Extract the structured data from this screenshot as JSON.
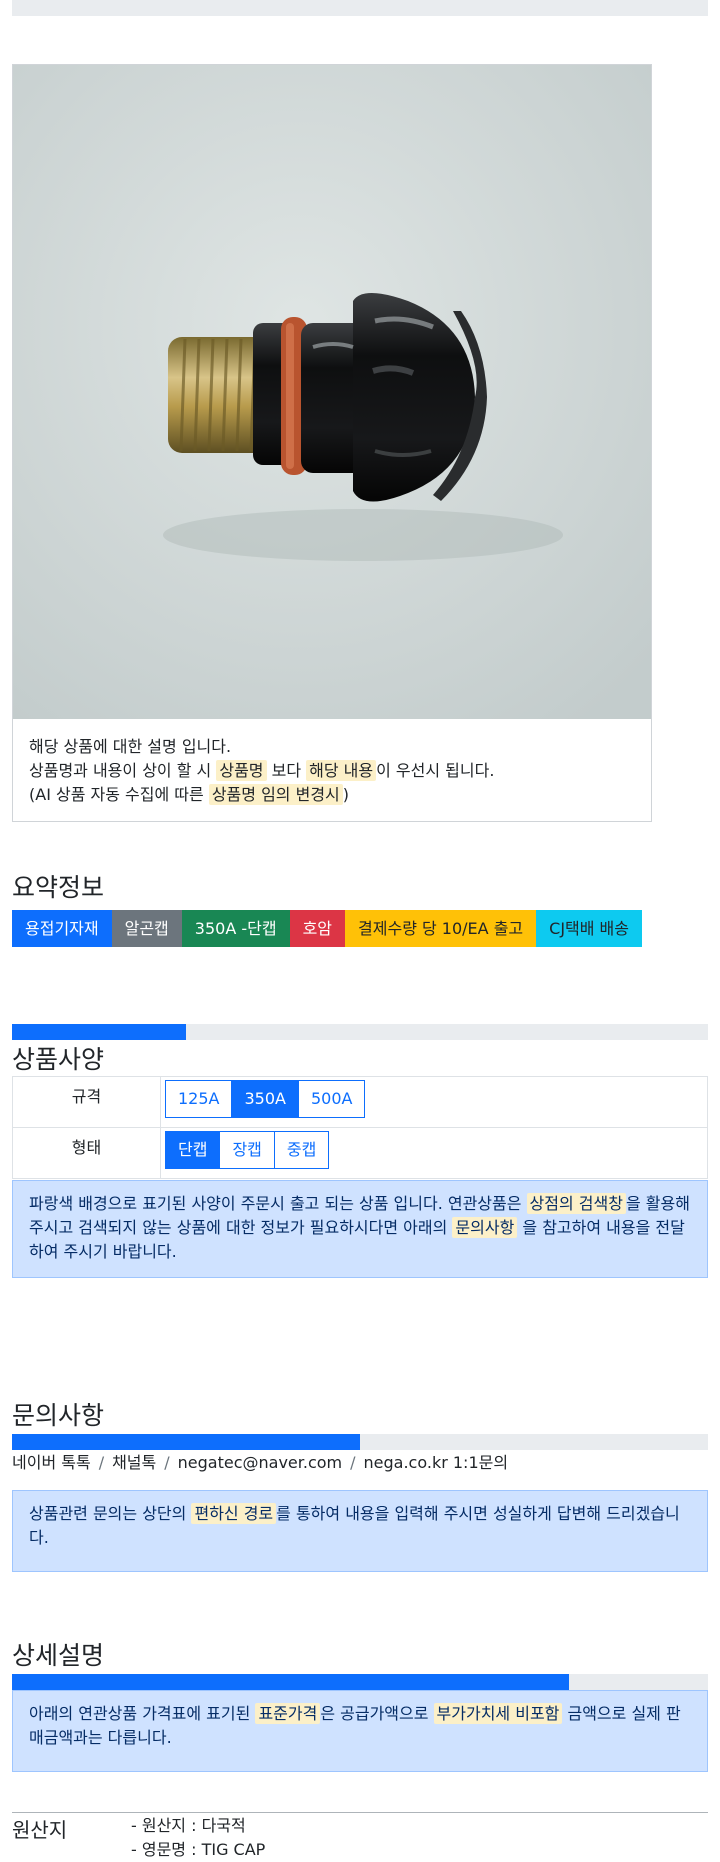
{
  "product_card": {
    "line1": "해당 상품에 대한 설명 입니다.",
    "line2_a": "상품명과 내용이 상이 할 시 ",
    "line2_mark1": "상품명",
    "line2_b": " 보다 ",
    "line2_mark2": "해당 내용",
    "line2_c": "이 우선시 됩니다.",
    "line3_a": "(AI 상품 자동 수집에 따른 ",
    "line3_mark": "상품명 임의 변경시",
    "line3_b": ")"
  },
  "summary": {
    "heading": "요약정보",
    "badges": [
      {
        "label": "용접기자재",
        "color": "#0d6efd"
      },
      {
        "label": "알곤캡",
        "color": "#6c757d"
      },
      {
        "label": "350A -단캡",
        "color": "#198754"
      },
      {
        "label": "호암",
        "color": "#dc3545"
      },
      {
        "label": "결제수량 당 10/EA 출고",
        "color": "#ffc107"
      },
      {
        "label": "CJ택배 배송",
        "color": "#0dcaf0"
      }
    ]
  },
  "spec": {
    "progress": 0.25,
    "heading": "상품사양",
    "rows": [
      {
        "label": "규격",
        "options": [
          "125A",
          "350A",
          "500A"
        ],
        "selected": "350A"
      },
      {
        "label": "형태",
        "options": [
          "단캡",
          "장캡",
          "중캡"
        ],
        "selected": "단캡"
      }
    ],
    "notice_a": "파랑색 배경으로 표기된 사양이 주문시 출고 되는 상품 입니다. 연관상품은 ",
    "notice_mark1": "상점의 검색창",
    "notice_b": "을 활용해 주시고 검색되지 않는 상품에 대한 정보가 필요하시다면 아래의 ",
    "notice_mark2": "문의사항",
    "notice_c": " 을 참고하여 내용을 전달하여 주시기 바랍니다."
  },
  "inquiry": {
    "heading": "문의사항",
    "progress": 0.5,
    "contacts": [
      "네이버 톡톡",
      "채널톡",
      "negatec@naver.com",
      "nega.co.kr 1:1문의"
    ],
    "separator": "/",
    "notice_a": "상품관련 문의는 상단의 ",
    "notice_mark": "편하신 경로",
    "notice_b": "를 통하여 내용을 입력해 주시면 성실하게 답변해 드리겠습니다."
  },
  "detail": {
    "heading": "상세설명",
    "progress": 0.8,
    "notice_a": "아래의 연관상품 가격표에 표기된 ",
    "notice_mark1": "표준가격",
    "notice_b": "은 공급가액으로 ",
    "notice_mark2": "부가가치세 비포함",
    "notice_c": " 금액으로 실제 판매금액과는 다릅니다."
  },
  "origin": {
    "label": "원산지",
    "items": [
      "- 원산지 : 다국적",
      "- 영문명 : TIG CAP"
    ]
  }
}
